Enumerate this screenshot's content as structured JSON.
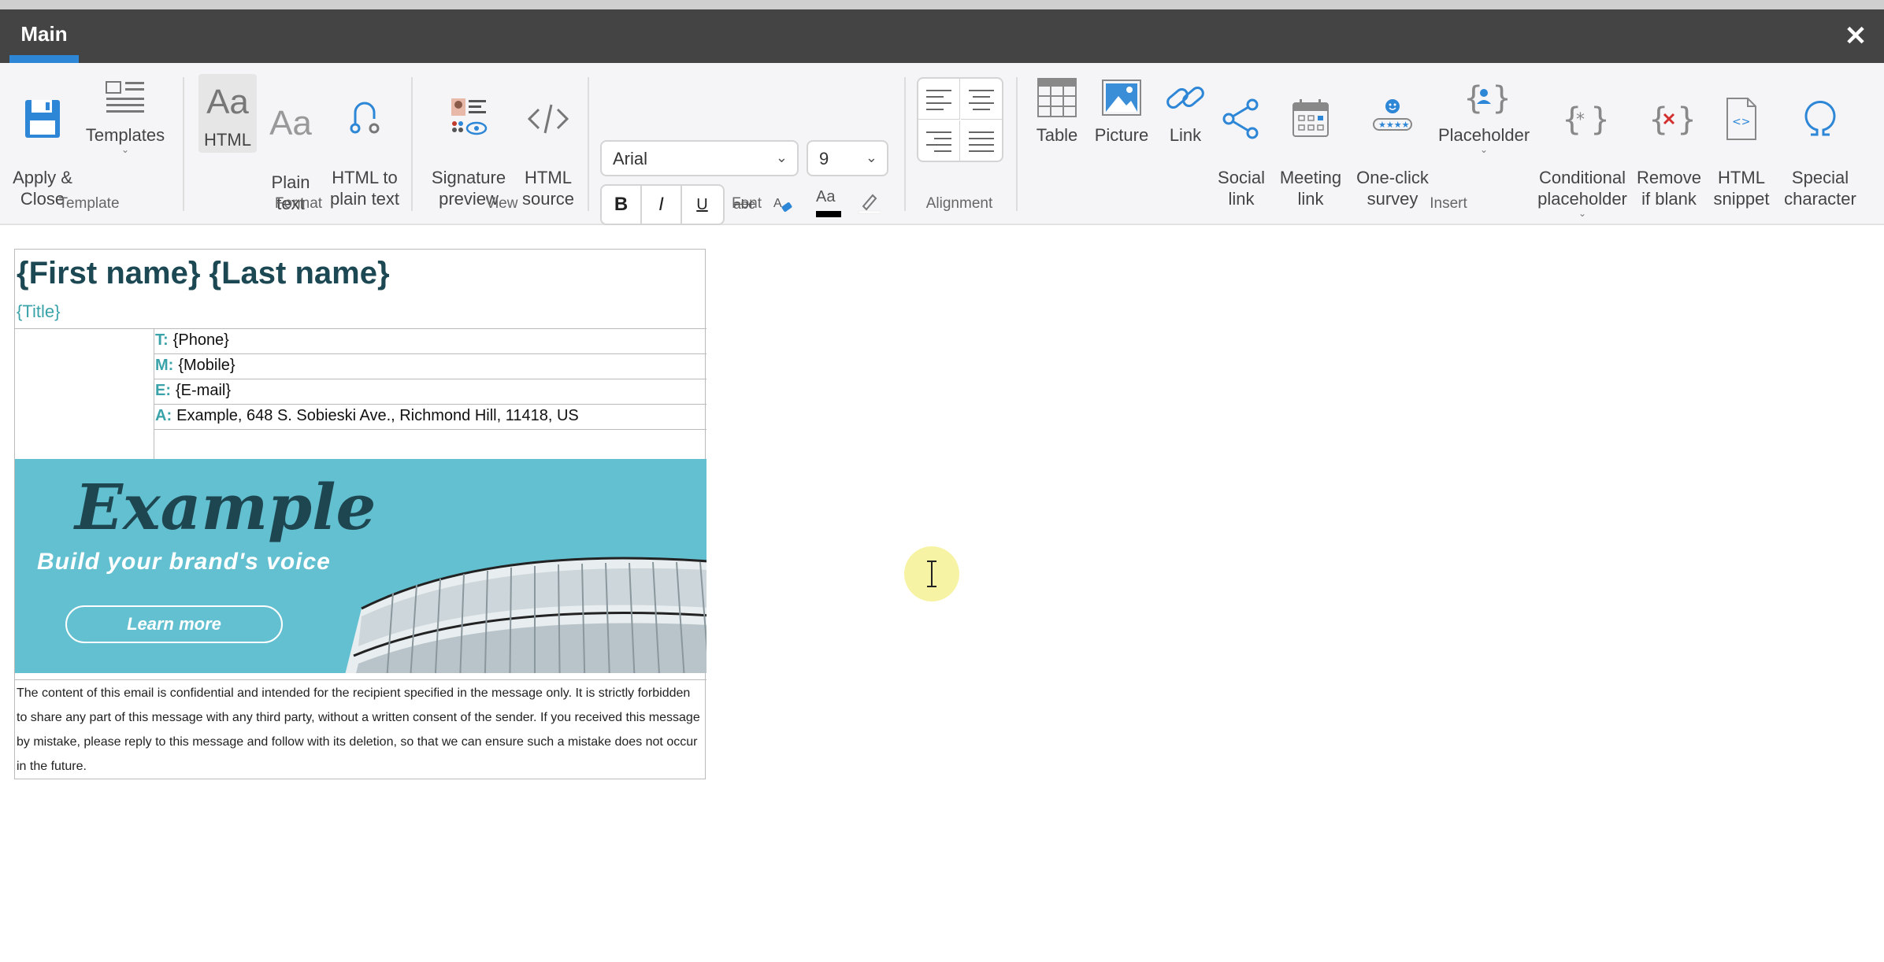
{
  "tabbar": {
    "tab_main": "Main",
    "close_glyph": "✕"
  },
  "ribbon": {
    "groups": {
      "template": "Template",
      "format": "Format",
      "view": "View",
      "font": "Font",
      "alignment": "Alignment",
      "insert": "Insert"
    },
    "template": {
      "apply_close": "Apply &\nClose",
      "templates": "Templates"
    },
    "format": {
      "html": "HTML",
      "plain_text": "Plain\ntext",
      "html_to_plain": "HTML to\nplain text"
    },
    "view": {
      "signature_preview": "Signature\npreview",
      "html_source": "HTML\nsource"
    },
    "font": {
      "family": "Arial",
      "size": "9",
      "bold": "B",
      "italic": "I",
      "underline": "U",
      "strike": "abc",
      "color_glyph": "Aa",
      "text_color": "#000000"
    },
    "insert": {
      "table": "Table",
      "picture": "Picture",
      "link": "Link",
      "social_link": "Social\nlink",
      "meeting_link": "Meeting\nlink",
      "survey": "One-click\nsurvey",
      "placeholder": "Placeholder",
      "conditional": "Conditional\nplaceholder",
      "remove_blank": "Remove\nif blank",
      "snippet": "HTML\nsnippet",
      "special_char": "Special\ncharacter"
    }
  },
  "signature": {
    "name": "{First name} {Last name}",
    "title": "{Title}",
    "contacts": [
      {
        "label": "T:",
        "value": "{Phone}"
      },
      {
        "label": "M:",
        "value": "{Mobile}"
      },
      {
        "label": "E:",
        "value": "{E-mail}"
      },
      {
        "label": "A:",
        "value": "Example, 648 S. Sobieski Ave., Richmond Hill, 11418, US"
      }
    ],
    "banner": {
      "brand": "Example",
      "tagline": "Build your brand's voice",
      "button": "Learn more"
    },
    "disclaimer": "The content of this email is confidential and intended for the recipient specified in the message only. It is strictly forbidden to share any part of this message with any third party, without a written consent of the sender. If you received this message by mistake, please reply to this message and follow with its deletion, so that we can ensure such a mistake does not occur in the future."
  },
  "colors": {
    "accent": "#2d86d6",
    "teal": "#3aa3aa",
    "name": "#1c4854",
    "banner": "#63c0d0"
  }
}
